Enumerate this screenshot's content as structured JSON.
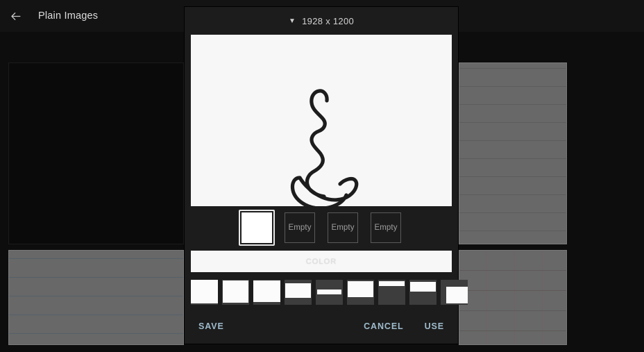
{
  "app": {
    "back_icon": "back-arrow-icon",
    "title": "Plain Images"
  },
  "background_cards": [
    {
      "name": "card-topleft",
      "style": "dark"
    },
    {
      "name": "card-bottomleft",
      "style": "gray-ruled"
    },
    {
      "name": "card-topright",
      "style": "gray-ruled-tight"
    },
    {
      "name": "card-bottomright",
      "style": "gray-grid"
    }
  ],
  "dialog": {
    "header": {
      "caret_icon": "▼",
      "dimensions": "1928 x 1200"
    },
    "canvas": {
      "artwork": "freehand-scribble",
      "stroke_color": "#1a1a1a",
      "background_color": "#f7f7f7"
    },
    "thumbnails": [
      {
        "label": "",
        "state": "selected",
        "filled": true
      },
      {
        "label": "Empty",
        "state": "empty",
        "filled": false
      },
      {
        "label": "Empty",
        "state": "empty",
        "filled": false
      },
      {
        "label": "Empty",
        "state": "empty",
        "filled": false
      }
    ],
    "color_button": {
      "label": "COLOR",
      "background": "#f7f7f7",
      "text_color": "#e2e2e2"
    },
    "patterns": [
      {
        "name": "plain-white-full"
      },
      {
        "name": "plain-white"
      },
      {
        "name": "plain-white-2"
      },
      {
        "name": "white-block-top"
      },
      {
        "name": "single-line-middle"
      },
      {
        "name": "block-upper"
      },
      {
        "name": "bar-top"
      },
      {
        "name": "band-upper"
      },
      {
        "name": "column-right"
      }
    ],
    "actions": {
      "save": "SAVE",
      "cancel": "CANCEL",
      "use": "USE",
      "text_color": "#9fbbcc"
    }
  }
}
